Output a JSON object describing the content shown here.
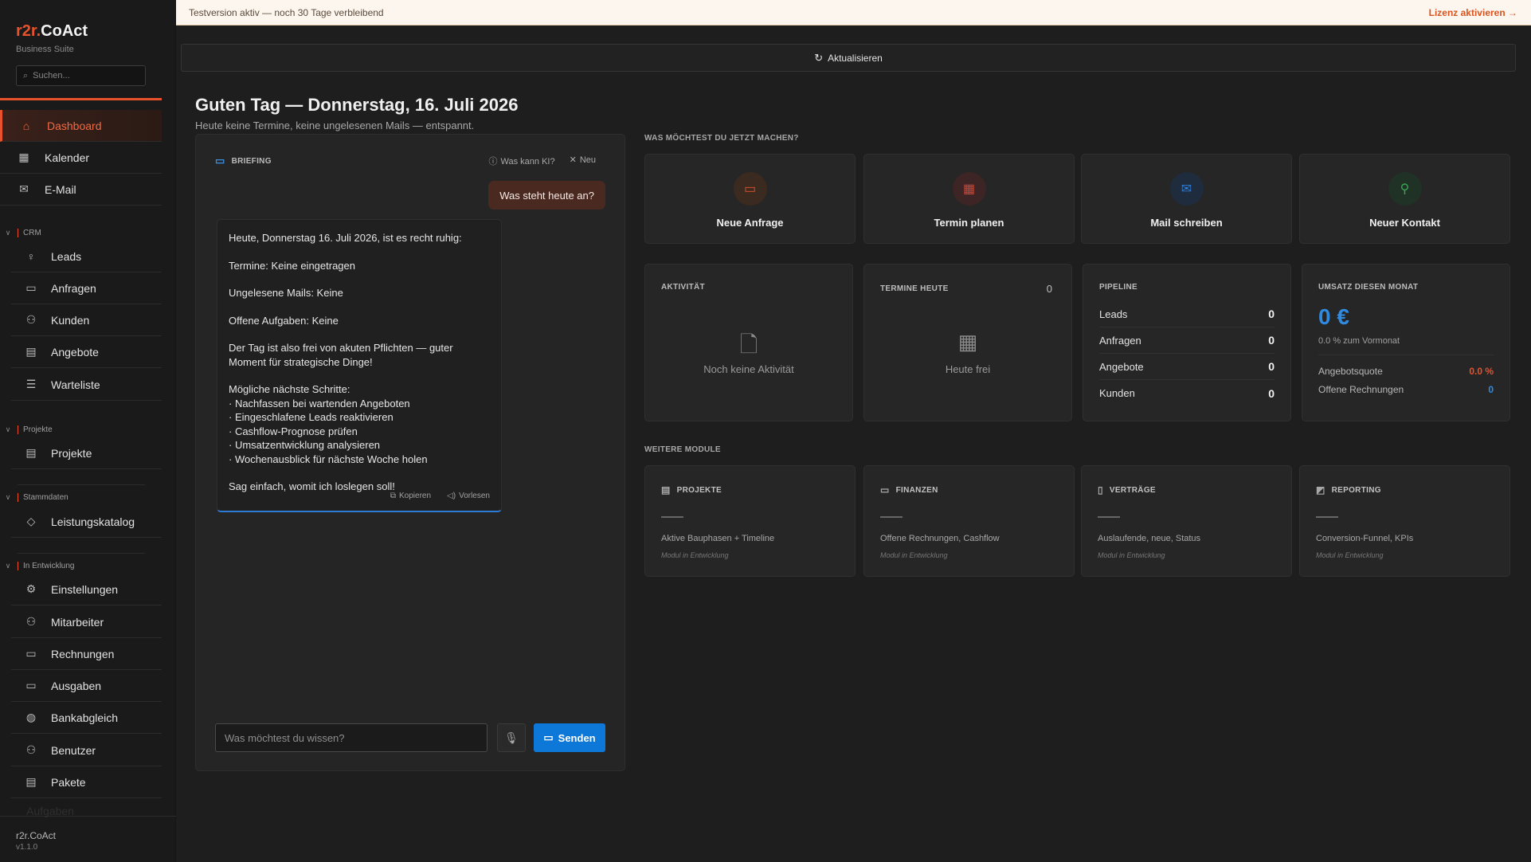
{
  "brand": {
    "prefix": "r2r.",
    "name": "CoAct",
    "subtitle": "Business Suite"
  },
  "search": {
    "placeholder": "Suchen..."
  },
  "nav": {
    "top": [
      {
        "label": "Dashboard",
        "icon": "home-icon",
        "active": true
      },
      {
        "label": "Kalender",
        "icon": "calendar-icon"
      },
      {
        "label": "E-Mail",
        "icon": "mail-icon"
      }
    ],
    "sections": {
      "crm": "CRM",
      "projekte": "Projekte",
      "stammdaten": "Stammdaten",
      "entwicklung": "In Entwicklung"
    },
    "crm": [
      {
        "label": "Leads",
        "icon": "lightbulb-icon"
      },
      {
        "label": "Anfragen",
        "icon": "chat-icon"
      },
      {
        "label": "Kunden",
        "icon": "users-icon"
      },
      {
        "label": "Angebote",
        "icon": "document-icon"
      },
      {
        "label": "Warteliste",
        "icon": "list-icon"
      }
    ],
    "projekte": [
      {
        "label": "Projekte",
        "icon": "folder-icon"
      }
    ],
    "stammdaten": [
      {
        "label": "Leistungskatalog",
        "icon": "tag-icon"
      }
    ],
    "entwicklung": [
      {
        "label": "Einstellungen",
        "icon": "gear-icon"
      },
      {
        "label": "Mitarbeiter",
        "icon": "users-icon"
      },
      {
        "label": "Rechnungen",
        "icon": "invoice-icon"
      },
      {
        "label": "Ausgaben",
        "icon": "wallet-icon"
      },
      {
        "label": "Bankabgleich",
        "icon": "globe-icon"
      },
      {
        "label": "Benutzer",
        "icon": "user-icon"
      },
      {
        "label": "Pakete",
        "icon": "package-icon"
      },
      {
        "label": "Aufgaben",
        "icon": "task-icon"
      }
    ]
  },
  "footer": {
    "name": "r2r.CoAct",
    "version": "v1.1.0"
  },
  "banner": {
    "text": "Testversion aktiv — noch 30 Tage verbleibend",
    "action": "Lizenz aktivieren →"
  },
  "refresh_label": "Aktualisieren",
  "greeting": {
    "title": "Guten Tag — Donnerstag, 16. Juli 2026",
    "subtitle": "Heute keine Termine, keine ungelesenen Mails — entspannt."
  },
  "chat": {
    "title": "BRIEFING",
    "help": "Was kann KI?",
    "new": "Neu",
    "user_message": "Was steht heute an?",
    "ai_lines": {
      "intro": "Heute, Donnerstag 16. Juli 2026, ist es recht ruhig:",
      "termine": "Termine: Keine eingetragen",
      "mails": "Ungelesene Mails: Keine",
      "aufgaben": "Offene Aufgaben: Keine",
      "frei": "Der Tag ist also frei von akuten Pflichten — guter Moment für strategische Dinge!",
      "next_title": "Mögliche nächste Schritte:",
      "steps": [
        "· Nachfassen bei wartenden Angeboten",
        "· Eingeschlafene Leads reaktivieren",
        "· Cashflow-Prognose prüfen",
        "· Umsatzentwicklung analysieren",
        "· Wochenausblick für nächste Woche holen"
      ],
      "outro": "Sag einfach, womit ich loslegen soll!"
    },
    "copy": "Kopieren",
    "read": "Vorlesen",
    "input_placeholder": "Was möchtest du wissen?",
    "send": "Senden"
  },
  "quick_actions": {
    "heading": "WAS MÖCHTEST DU JETZT MACHEN?",
    "items": [
      {
        "label": "Neue Anfrage",
        "icon": "chat-icon",
        "color": "#e8512a"
      },
      {
        "label": "Termin planen",
        "icon": "calendar-icon",
        "color": "#c94a3a"
      },
      {
        "label": "Mail schreiben",
        "icon": "mail-icon",
        "color": "#2f7ed8"
      },
      {
        "label": "Neuer Kontakt",
        "icon": "user-plus-icon",
        "color": "#3aa655"
      }
    ]
  },
  "stats": {
    "activity": {
      "title": "AKTIVITÄT",
      "empty": "Noch keine Aktivität"
    },
    "termine": {
      "title": "TERMINE HEUTE",
      "count": "0",
      "empty": "Heute frei"
    },
    "pipeline": {
      "title": "PIPELINE",
      "rows": [
        {
          "label": "Leads",
          "value": "0"
        },
        {
          "label": "Anfragen",
          "value": "0"
        },
        {
          "label": "Angebote",
          "value": "0"
        },
        {
          "label": "Kunden",
          "value": "0"
        }
      ]
    },
    "umsatz": {
      "title": "UMSATZ DIESEN MONAT",
      "value": "0 €",
      "sub": "0.0 % zum Vormonat",
      "quote_label": "Angebotsquote",
      "quote_value": "0.0 %",
      "open_label": "Offene Rechnungen",
      "open_value": "0"
    }
  },
  "modules": {
    "heading": "WEITERE MODULE",
    "items": [
      {
        "title": "PROJEKTE",
        "icon": "folder-icon",
        "desc": "Aktive Bauphasen + Timeline",
        "note": "Modul in Entwicklung"
      },
      {
        "title": "FINANZEN",
        "icon": "invoice-icon",
        "desc": "Offene Rechnungen, Cashflow",
        "note": "Modul in Entwicklung"
      },
      {
        "title": "VERTRÄGE",
        "icon": "document-icon",
        "desc": "Auslaufende, neue, Status",
        "note": "Modul in Entwicklung"
      },
      {
        "title": "REPORTING",
        "icon": "chart-icon",
        "desc": "Conversion-Funnel, KPIs",
        "note": "Modul in Entwicklung"
      }
    ]
  }
}
